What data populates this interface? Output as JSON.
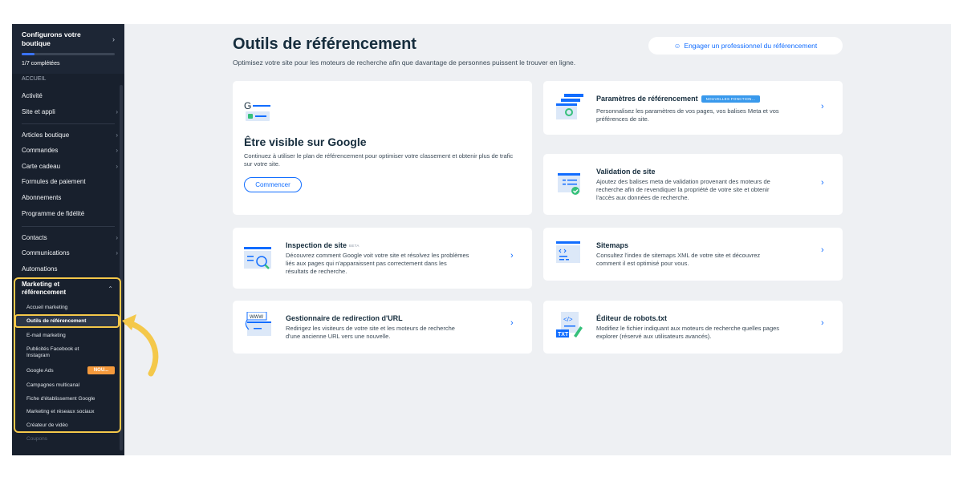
{
  "sidebar": {
    "setup_title": "Configurons votre boutique",
    "progress_label": "1/7 complétées",
    "progress_fraction": 0.14,
    "items": [
      {
        "label": "Accueil"
      },
      {
        "label": "Activité"
      },
      {
        "label": "Site et appli"
      },
      {
        "label": "Articles boutique"
      },
      {
        "label": "Commandes"
      },
      {
        "label": "Carte cadeau"
      },
      {
        "label": "Formules de paiement"
      },
      {
        "label": "Abonnements"
      },
      {
        "label": "Programme de fidélité"
      },
      {
        "label": "Contacts"
      },
      {
        "label": "Communications"
      },
      {
        "label": "Automations"
      }
    ],
    "marketing": {
      "title": "Marketing et référencement",
      "subitems": [
        {
          "label": "Accueil marketing"
        },
        {
          "label": "Outils de référencement"
        },
        {
          "label": "E-mail marketing"
        },
        {
          "label": "Publicités Facebook et Instagram"
        },
        {
          "label": "Google Ads"
        },
        {
          "label": "Campagnes multicanal"
        },
        {
          "label": "Fiche d'établissement Google"
        },
        {
          "label": "Marketing et réseaux sociaux"
        },
        {
          "label": "Créateur de vidéo"
        }
      ],
      "google_ads_badge": "NOU..."
    },
    "footer_item": "Coupons"
  },
  "main": {
    "title": "Outils de référencement",
    "subtitle": "Optimisez votre site pour les moteurs de recherche afin que davantage de personnes puissent le trouver en ligne.",
    "pro_button": "Engager un professionnel du référencement",
    "google_card": {
      "title": "Être visible sur Google",
      "description": "Continuez à utiliser le plan de référencement pour optimiser votre classement et obtenir plus de trafic sur votre site.",
      "button": "Commencer"
    },
    "cards": {
      "seo_settings": {
        "title": "Paramètres de référencement",
        "tag": "NOUVELLES FONCTION...",
        "description": "Personnalisez les paramètres de vos pages, vos balises Meta et vos préférences de site."
      },
      "site_verification": {
        "title": "Validation de site",
        "description": "Ajoutez des balises meta de validation provenant des moteurs de recherche afin de revendiquer la propriété de votre site et obtenir l'accès aux données de recherche."
      },
      "site_inspection": {
        "title": "Inspection de site",
        "tag": "BETA",
        "description": "Découvrez comment Google voit votre site et résolvez les problèmes liés aux pages qui n'apparaissent pas correctement dans les résultats de recherche."
      },
      "sitemaps": {
        "title": "Sitemaps",
        "description": "Consultez l'index de sitemaps XML de votre site et découvrez comment il est optimisé pour vous."
      },
      "url_redirect": {
        "title": "Gestionnaire de redirection d'URL",
        "description": "Redirigez les visiteurs de votre site et les moteurs de recherche d'une ancienne URL vers une nouvelle."
      },
      "robots": {
        "title": "Éditeur de robots.txt",
        "description": "Modifiez le fichier indiquant aux moteurs de recherche quelles pages explorer (réservé aux utilisateurs avancés)."
      }
    },
    "icon_text": {
      "google_g": "G",
      "www": "WWW",
      "code": "</>",
      "txt": "TXT"
    }
  },
  "colors": {
    "accent": "#116dff",
    "sidebar_bg": "#18202d",
    "highlight": "#f4c84a",
    "badge": "#f59a3c",
    "canvas": "#eef0f3"
  }
}
